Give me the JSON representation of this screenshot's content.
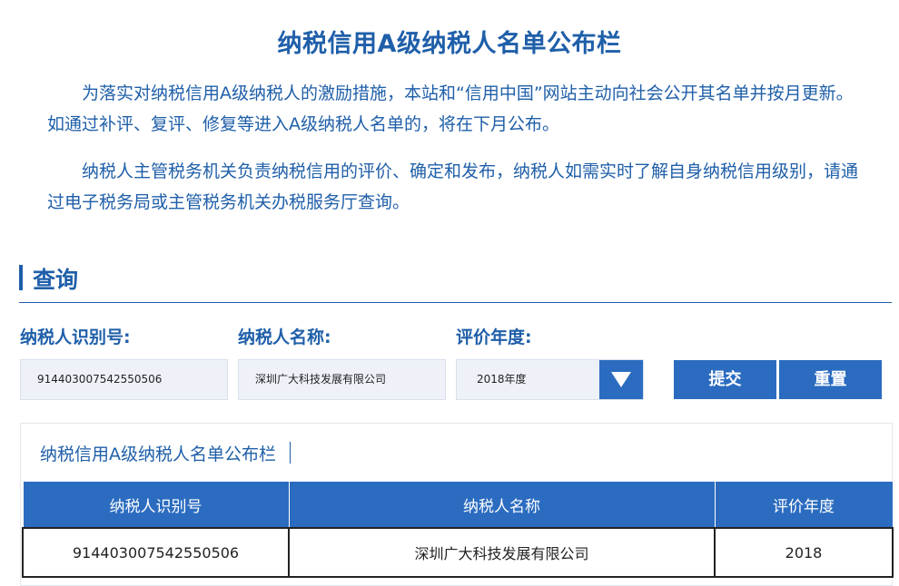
{
  "page_title": "纳税信用A级纳税人名单公布栏",
  "intro": {
    "paragraph_1": "为落实对纳税信用A级纳税人的激励措施，本站和“信用中国”网站主动向社会公开其名单并按月更新。如通过补评、复评、修复等进入A级纳税人名单的，将在下月公布。",
    "paragraph_2": "纳税人主管税务机关负责纳税信用的评价、确定和发布，纳税人如需实时了解自身纳税信用级别，请通过电子税务局或主管税务机关办税服务厅查询。"
  },
  "query_section": {
    "title": "查询",
    "taxpayer_id_label": "纳税人识别号:",
    "taxpayer_id_value": "914403007542550506",
    "taxpayer_name_label": "纳税人名称:",
    "taxpayer_name_value": "深圳广大科技发展有限公司",
    "year_label": "评价年度:",
    "year_selected": "2018年度",
    "submit_label": "提交",
    "reset_label": "重置"
  },
  "results": {
    "title": "纳税信用A级纳税人名单公布栏",
    "columns": [
      "纳税人识别号",
      "纳税人名称",
      "评价年度"
    ],
    "rows": [
      [
        "914403007542550506",
        "深圳广大科技发展有限公司",
        "2018"
      ]
    ]
  },
  "colors": {
    "accent": "#1f5fa9",
    "button": "#2b6cc0",
    "field_bg": "#eef2f8"
  },
  "icons": {
    "select_arrow": "triangle-down-icon"
  }
}
